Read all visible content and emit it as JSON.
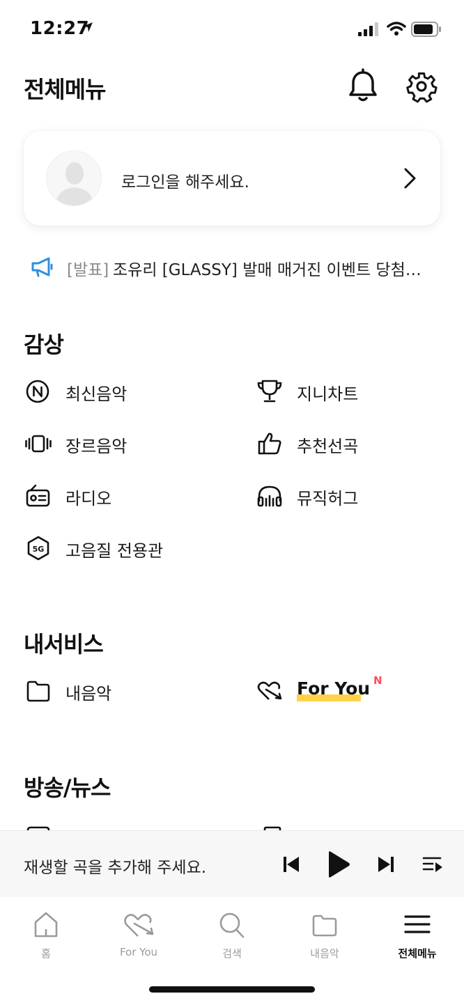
{
  "status": {
    "time": "12:27"
  },
  "header": {
    "title": "전체메뉴"
  },
  "login": {
    "text": "로그인을 해주세요."
  },
  "notice": {
    "prefix": "[발표]",
    "text": "조유리 [GLASSY] 발매 매거진 이벤트 당첨…"
  },
  "sections": {
    "appreciation": {
      "title": "감상",
      "items": [
        {
          "label": "최신음악",
          "icon": "new-music-icon"
        },
        {
          "label": "지니차트",
          "icon": "trophy-icon"
        },
        {
          "label": "장르음악",
          "icon": "vibrate-icon"
        },
        {
          "label": "추천선곡",
          "icon": "thumbs-up-icon"
        },
        {
          "label": "라디오",
          "icon": "radio-icon"
        },
        {
          "label": "뮤직허그",
          "icon": "headphones-icon"
        },
        {
          "label": "고음질 전용관",
          "icon": "5g-icon"
        }
      ]
    },
    "my_service": {
      "title": "내서비스",
      "items": [
        {
          "label": "내음악",
          "icon": "folder-icon"
        },
        {
          "label": "For You",
          "icon": "heart-arrow-icon",
          "badge": "N"
        }
      ]
    },
    "broadcast": {
      "title": "방송/뉴스"
    }
  },
  "player": {
    "empty_text": "재생할 곡을 추가해 주세요."
  },
  "tabbar": {
    "tabs": [
      {
        "label": "홈",
        "icon": "home-icon"
      },
      {
        "label": "For You",
        "icon": "heart-arrow-icon"
      },
      {
        "label": "검색",
        "icon": "search-icon"
      },
      {
        "label": "내음악",
        "icon": "folder-icon"
      },
      {
        "label": "전체메뉴",
        "icon": "menu-icon",
        "active": true
      }
    ]
  },
  "colors": {
    "accent_yellow": "#ffd24a",
    "badge_red": "#ff4a5a",
    "notice_blue": "#2f8fe0"
  }
}
